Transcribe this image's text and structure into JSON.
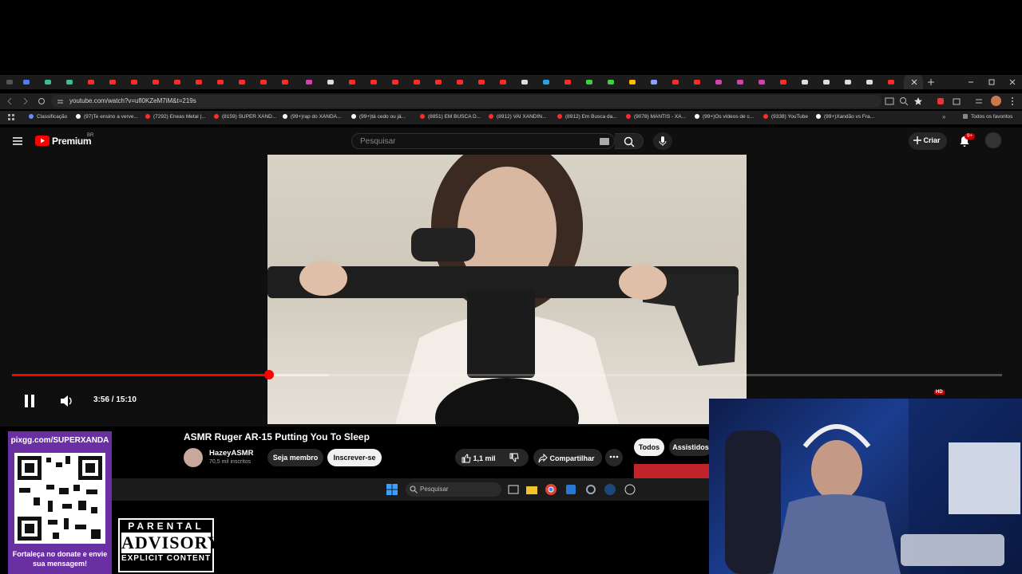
{
  "browser": {
    "url": "youtube.com/watch?v=ufl0KZeM7iM&t=219s",
    "bookmarks": [
      {
        "label": "Classificação",
        "color": "#6b8cff"
      },
      {
        "label": "(97)Te ensino a verve...",
        "color": "#ffffff"
      },
      {
        "label": "(7292) Eneas Metal |...",
        "color": "#ff2b2b"
      },
      {
        "label": "(8159) SUPER XAND...",
        "color": "#ff2b2b"
      },
      {
        "label": "(99+)rap do XANDÃ...",
        "color": "#ffffff"
      },
      {
        "label": "(99+)tá cedo ou já...",
        "color": "#ffffff"
      },
      {
        "label": "(8851) EM BUSCA D...",
        "color": "#ff2b2b"
      },
      {
        "label": "(8912) VAI XANDIN...",
        "color": "#ff2b2b"
      },
      {
        "label": "(8912) Em Busca da...",
        "color": "#ff2b2b"
      },
      {
        "label": "(9078) MANTIS - XA...",
        "color": "#ff2b2b"
      },
      {
        "label": "(99+)Os vídeos de c...",
        "color": "#ffffff"
      },
      {
        "label": "(9338) YouTube",
        "color": "#ff2b2b"
      },
      {
        "label": "(99+)Xandão vs Fra...",
        "color": "#ffffff"
      }
    ],
    "all_bookmarks": "Todos os favoritos"
  },
  "youtube": {
    "logo": "Premium",
    "logo_region": "BR",
    "search_placeholder": "Pesquisar",
    "create_label": "Criar",
    "notif_count": "9+",
    "player": {
      "time": "3:56 / 15:10",
      "progress": 0.26,
      "buffered": 0.32,
      "hd_badge": "HD"
    },
    "video": {
      "title": "ASMR Ruger AR-15 Putting You To Sleep",
      "channel": "HazeyASMR",
      "subscribers": "70,5 mil inscritos",
      "member_label": "Seja membro",
      "subscribe_label": "Inscrever-se",
      "likes": "1,1 mil",
      "share_label": "Compartilhar",
      "chips": [
        "Todos",
        "Assistidos"
      ]
    }
  },
  "taskbar": {
    "search_placeholder": "Pesquisar"
  },
  "overlay": {
    "pix_url": "pixgg.com/SUPERXANDA",
    "donate_text": "Fortaleça no donate e envie sua mensagem!",
    "pa_line1": "PARENTAL",
    "pa_line2": "ADVISORY",
    "pa_line3": "EXPLICIT CONTENT",
    "brand_color": "#6b2fa4"
  }
}
